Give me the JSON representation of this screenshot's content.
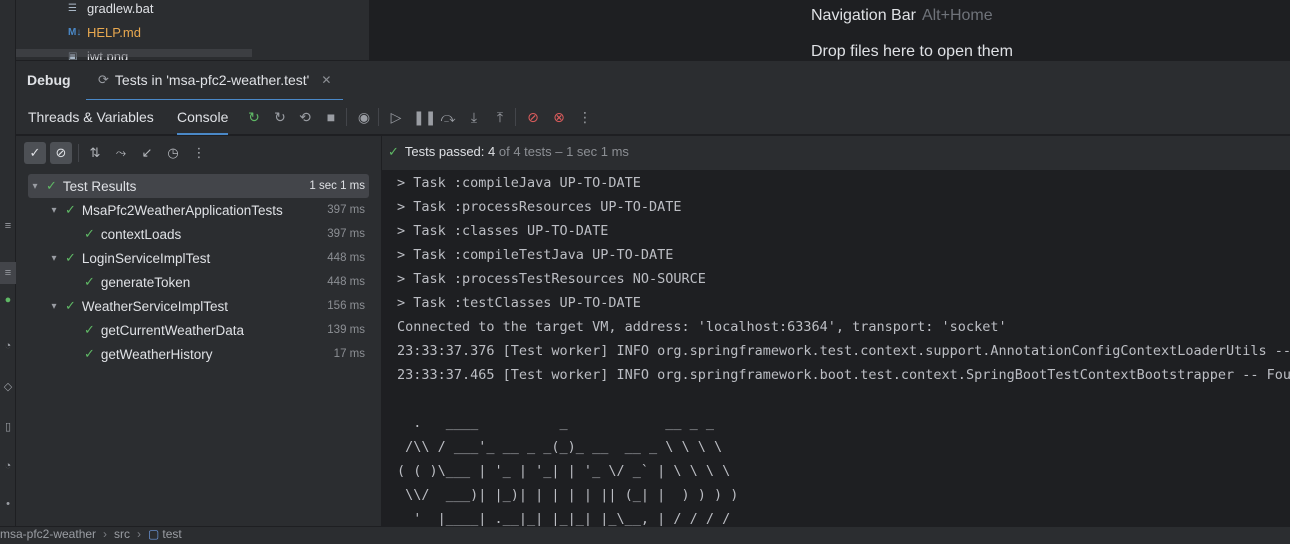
{
  "colors": {
    "accent": "#4a88c7",
    "pass": "#5fb865",
    "bg": "#1e1f22",
    "panel": "#2b2d30"
  },
  "project_tree": {
    "files": [
      {
        "name": "gradlew.bat",
        "icon": "text-file-icon",
        "color": "#dfe1e5"
      },
      {
        "name": "HELP.md",
        "icon": "markdown-file-icon",
        "color": "#e8a84f"
      },
      {
        "name": "jwt.png",
        "icon": "image-file-icon",
        "color": "#dfe1e5"
      }
    ]
  },
  "editor_hints": {
    "nav_label": "Navigation Bar",
    "nav_key": "Alt+Home",
    "drop_text": "Drop files here to open them"
  },
  "debug": {
    "title": "Debug",
    "tab_label": "Tests in 'msa-pfc2-weather.test'",
    "subtabs": [
      "Threads & Variables",
      "Console"
    ],
    "active_subtab": "Console"
  },
  "status": {
    "prefix": "Tests passed: ",
    "passed": "4",
    "suffix": " of 4 tests – 1 sec 1 ms"
  },
  "test_tree": {
    "rows": [
      {
        "name": "Test Results",
        "duration": "1 sec 1 ms"
      },
      {
        "name": "MsaPfc2WeatherApplicationTests",
        "duration": "397 ms"
      },
      {
        "name": "contextLoads",
        "duration": "397 ms"
      },
      {
        "name": "LoginServiceImplTest",
        "duration": "448 ms"
      },
      {
        "name": "generateToken",
        "duration": "448 ms"
      },
      {
        "name": "WeatherServiceImplTest",
        "duration": "156 ms"
      },
      {
        "name": "getCurrentWeatherData",
        "duration": "139 ms"
      },
      {
        "name": "getWeatherHistory",
        "duration": "17 ms"
      }
    ]
  },
  "console_lines": [
    "> Task :compileJava UP-TO-DATE",
    "> Task :processResources UP-TO-DATE",
    "> Task :classes UP-TO-DATE",
    "> Task :compileTestJava UP-TO-DATE",
    "> Task :processTestResources NO-SOURCE",
    "> Task :testClasses UP-TO-DATE",
    "Connected to the target VM, address: 'localhost:63364', transport: 'socket'",
    "23:33:37.376 [Test worker] INFO org.springframework.test.context.support.AnnotationConfigContextLoaderUtils -- C",
    "23:33:37.465 [Test worker] INFO org.springframework.boot.test.context.SpringBootTestContextBootstrapper -- Found",
    "",
    "  .   ____          _            __ _ _",
    " /\\\\ / ___'_ __ _ _(_)_ __  __ _ \\ \\ \\ \\",
    "( ( )\\___ | '_ | '_| | '_ \\/ _` | \\ \\ \\ \\",
    " \\\\/  ___)| |_)| | | | | || (_| |  ) ) ) )",
    "  '  |____| .__|_| |_|_| |_\\__, | / / / /"
  ],
  "breadcrumb": [
    "msa-pfc2-weather",
    "src",
    "test"
  ]
}
